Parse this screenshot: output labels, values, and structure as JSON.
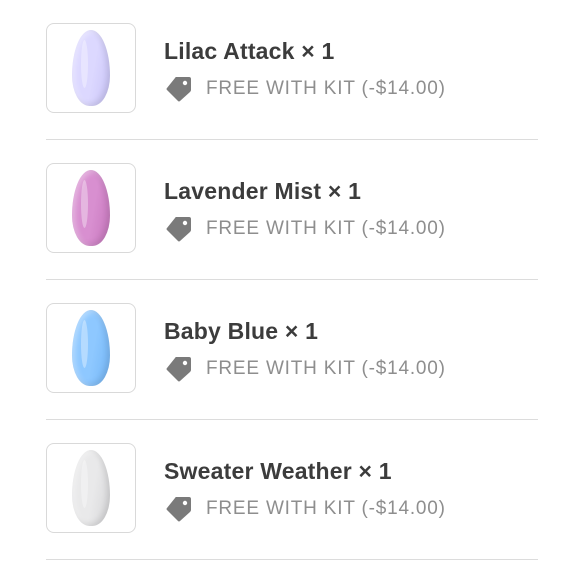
{
  "items": [
    {
      "title": "Lilac Attack × 1",
      "promo": "FREE WITH KIT (-$14.00)",
      "nail_color": "#dcd8ff",
      "nail_color_edge": "#c9c4f7",
      "tag_icon": "price-tag-icon"
    },
    {
      "title": "Lavender Mist × 1",
      "promo": "FREE WITH KIT (-$14.00)",
      "nail_color": "#d88fd0",
      "nail_color_edge": "#c676bc",
      "tag_icon": "price-tag-icon"
    },
    {
      "title": "Baby Blue × 1",
      "promo": "FREE WITH KIT (-$14.00)",
      "nail_color": "#8ec8ff",
      "nail_color_edge": "#74b6f6",
      "tag_icon": "price-tag-icon"
    },
    {
      "title": "Sweater Weather × 1",
      "promo": "FREE WITH KIT (-$14.00)",
      "nail_color": "#e9e9ea",
      "nail_color_edge": "#d6d6d8",
      "tag_icon": "price-tag-icon"
    }
  ],
  "colors": {
    "title_text": "#3c3c3c",
    "promo_text": "#8e8e8e",
    "tag_icon": "#7a7a7a",
    "divider": "#dcdcdc",
    "thumb_border": "#d9d9d9"
  }
}
